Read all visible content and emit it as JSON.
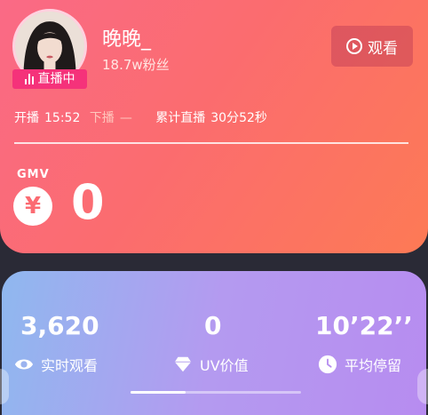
{
  "host": {
    "name": "晚晚_",
    "fans": "18.7w粉丝",
    "live_badge": "直播中",
    "watch_label": "观看"
  },
  "session": {
    "start_label": "开播",
    "start_time": "15:52",
    "end_label": "下播",
    "end_time": "—",
    "duration_label": "累计直播",
    "duration": "30分52秒"
  },
  "gmv": {
    "label": "GMV",
    "currency_symbol": "¥",
    "value": "0"
  },
  "metrics": [
    {
      "value": "3,620",
      "label": "实时观看",
      "icon": "eye-icon"
    },
    {
      "value": "0",
      "label": "UV价值",
      "icon": "diamond-icon"
    },
    {
      "value": "10’22’’",
      "label": "平均停留",
      "icon": "clock-icon"
    }
  ],
  "colors": {
    "top_gradient": [
      "#fa6a86",
      "#fd7a55"
    ],
    "badge": "#f5327a",
    "bottom_gradient": [
      "#8fb8ef",
      "#b78cf0"
    ]
  }
}
